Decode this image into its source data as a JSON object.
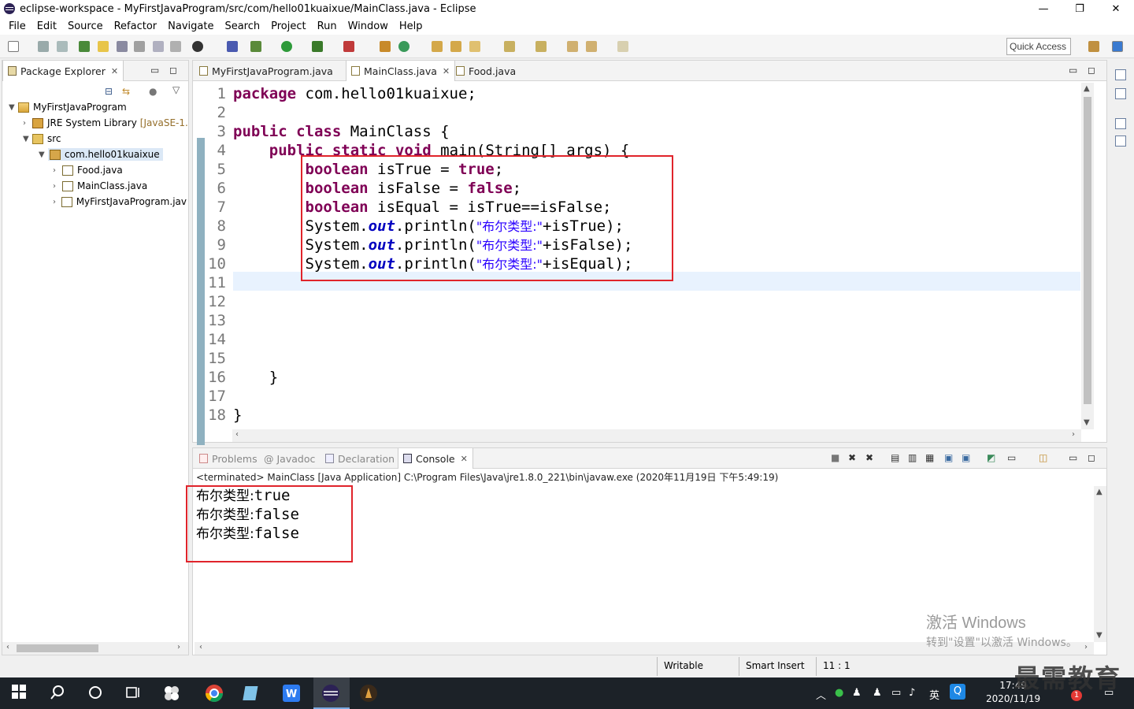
{
  "window": {
    "title": "eclipse-workspace - MyFirstJavaProgram/src/com/hello01kuaixue/MainClass.java - Eclipse",
    "minimize": "—",
    "restore": "❐",
    "close": "✕"
  },
  "menu": [
    "File",
    "Edit",
    "Source",
    "Refactor",
    "Navigate",
    "Search",
    "Project",
    "Run",
    "Window",
    "Help"
  ],
  "toolbar": {
    "quick_access": "Quick Access"
  },
  "package_explorer": {
    "tab_label": "Package Explorer",
    "tree": [
      {
        "label": "MyFirstJavaProgram",
        "note": ""
      },
      {
        "label": "JRE System Library",
        "note": "[JavaSE-1."
      },
      {
        "label": "src",
        "note": ""
      },
      {
        "label": "com.hello01kuaixue",
        "note": ""
      },
      {
        "label": "Food.java",
        "note": ""
      },
      {
        "label": "MainClass.java",
        "note": ""
      },
      {
        "label": "MyFirstJavaProgram.jav",
        "note": ""
      }
    ]
  },
  "editor": {
    "tabs": [
      "MyFirstJavaProgram.java",
      "MainClass.java",
      "Food.java"
    ],
    "active_tab": "MainClass.java",
    "line_numbers": [
      "1",
      "2",
      "3",
      "4",
      "5",
      "6",
      "7",
      "8",
      "9",
      "10",
      "11",
      "12",
      "13",
      "14",
      "15",
      "16",
      "17",
      "18"
    ],
    "code": {
      "l1_kw": "package",
      "l1_rest": " com.hello01kuaixue;",
      "l3_kw1": "public",
      "l3_kw2": "class",
      "l3_rest": " MainClass {",
      "l4_kw1": "public",
      "l4_kw2": "static",
      "l4_kw3": "void",
      "l4_rest": " main(String[] args) {",
      "l5_kw": "boolean",
      "l5_rest": " isTrue = ",
      "l5_val": "true",
      "l5_end": ";",
      "l6_kw": "boolean",
      "l6_rest": " isFalse = ",
      "l6_val": "false",
      "l6_end": ";",
      "l7_kw": "boolean",
      "l7_rest": " isEqual = isTrue==isFalse;",
      "sys": "System.",
      "out": "out",
      "println": ".println(",
      "str": "\"布尔类型:\"",
      "l8_end": "+isTrue);",
      "l9_end": "+isFalse);",
      "l10_end": "+isEqual);",
      "l16": "}",
      "l18": "}"
    }
  },
  "bottom_panel": {
    "tabs": [
      "Problems",
      "Javadoc",
      "Declaration",
      "Console"
    ],
    "active_tab": "Console",
    "header": "<terminated> MainClass [Java Application] C:\\Program Files\\Java\\jre1.8.0_221\\bin\\javaw.exe (2020年11月19日 下午5:49:19)",
    "output": [
      {
        "label": "布尔类型:",
        "value": "true"
      },
      {
        "label": "布尔类型:",
        "value": "false"
      },
      {
        "label": "布尔类型:",
        "value": "false"
      }
    ]
  },
  "status": {
    "writable": "Writable",
    "insert_mode": "Smart Insert",
    "position": "11 : 1"
  },
  "watermark": {
    "line1": "激活 Windows",
    "line2": "转到\"设置\"以激活 Windows。"
  },
  "taskbar": {
    "time": "17:49",
    "date": "2020/11/19",
    "ime": "英",
    "brand": "最需教育"
  },
  "colors": {
    "keyword": "#7f0055",
    "string": "#2a00ff",
    "field": "#0000c0",
    "highlight_box": "#e0242b"
  }
}
